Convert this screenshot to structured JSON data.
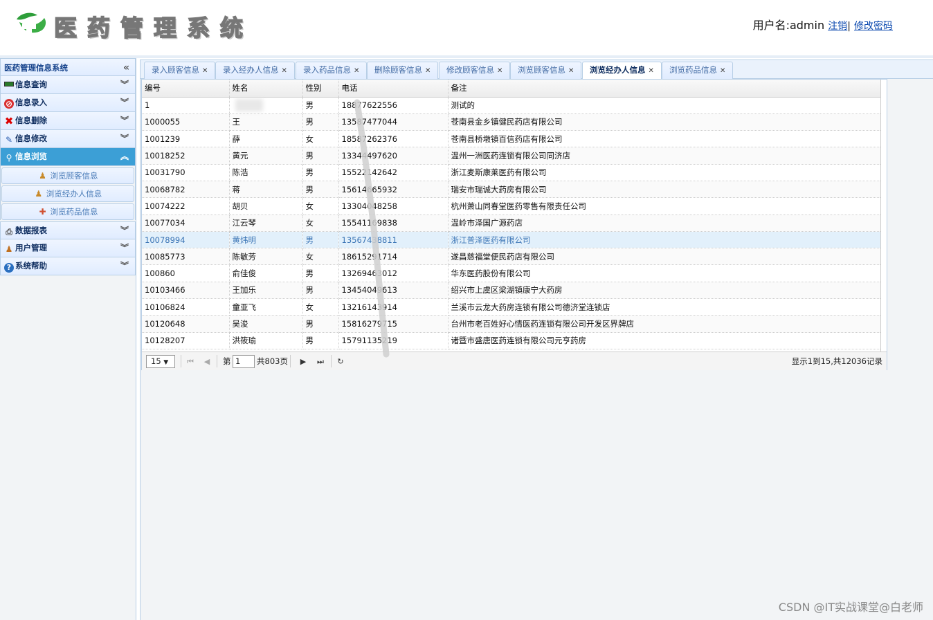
{
  "header": {
    "app_title": "医药管理系统",
    "user_label": "用户名:admin",
    "logout_link": "注销",
    "separator": "|",
    "change_password_link": "修改密码"
  },
  "sidebar": {
    "title": "医药管理信息系统",
    "items": [
      {
        "label": "信息查询",
        "icon": "monitor-icon"
      },
      {
        "label": "信息录入",
        "icon": "record-icon"
      },
      {
        "label": "信息删除",
        "icon": "delete-x-icon"
      },
      {
        "label": "信息修改",
        "icon": "pencil-icon"
      },
      {
        "label": "信息浏览",
        "icon": "search-icon",
        "active": true
      },
      {
        "label": "数据报表",
        "icon": "printer-icon"
      },
      {
        "label": "用户管理",
        "icon": "user-icon"
      },
      {
        "label": "系统帮助",
        "icon": "help-icon"
      }
    ],
    "subitems": [
      {
        "label": "浏览顾客信息",
        "icon": "customer-icon"
      },
      {
        "label": "浏览经办人信息",
        "icon": "agent-icon"
      },
      {
        "label": "浏览药品信息",
        "icon": "medicine-icon"
      }
    ]
  },
  "tabs": [
    {
      "label": "录入顾客信息"
    },
    {
      "label": "录入经办人信息"
    },
    {
      "label": "录入药品信息"
    },
    {
      "label": "删除顾客信息"
    },
    {
      "label": "修改顾客信息"
    },
    {
      "label": "浏览顾客信息"
    },
    {
      "label": "浏览经办人信息",
      "active": true
    },
    {
      "label": "浏览药品信息"
    }
  ],
  "grid": {
    "columns": [
      "编号",
      "姓名",
      "性别",
      "电话",
      "备注"
    ],
    "rows": [
      [
        "1",
        "",
        "男",
        "18877622556",
        "测试的"
      ],
      [
        "1000055",
        "王",
        "男",
        "13587477044",
        "苍南县金乡镇健民药店有限公司"
      ],
      [
        "1001239",
        "薛",
        "女",
        "18587262376",
        "苍南县桥墩镇百信药店有限公司"
      ],
      [
        "10018252",
        "黄元",
        "男",
        "13344497620",
        "温州一洲医药连锁有限公司同济店"
      ],
      [
        "10031790",
        "陈浩",
        "男",
        "15522142642",
        "浙江麦斯康莱医药有限公司"
      ],
      [
        "10068782",
        "蒋",
        "男",
        "15614665932",
        "瑞安市瑞诚大药房有限公司"
      ],
      [
        "10074222",
        "胡贝",
        "女",
        "13304048258",
        "杭州萧山同春堂医药零售有限责任公司"
      ],
      [
        "10077034",
        "江云琴",
        "女",
        "15541169838",
        "温岭市泽国广源药店"
      ],
      [
        "10078994",
        "黄炜明",
        "男",
        "13567438811",
        "浙江普泽医药有限公司"
      ],
      [
        "10085773",
        "陈敏芳",
        "女",
        "18615291714",
        "遂昌慈福堂便民药店有限公司"
      ],
      [
        "100860",
        "俞佳俊",
        "男",
        "13269463012",
        "华东医药股份有限公司"
      ],
      [
        "10103466",
        "王加乐",
        "男",
        "13454049613",
        "绍兴市上虞区梁湖镇康宁大药房"
      ],
      [
        "10106824",
        "童亚飞",
        "女",
        "13216143914",
        "兰溪市云龙大药房连锁有限公司德济堂连锁店"
      ],
      [
        "10120648",
        "吴浚",
        "男",
        "15816279715",
        "台州市老百姓好心情医药连锁有限公司开发区界牌店"
      ],
      [
        "10128207",
        "洪筱瑜",
        "男",
        "15791135219",
        "诸暨市盛唐医药连锁有限公司元亨药房"
      ]
    ]
  },
  "pager": {
    "page_size": "15",
    "page_prefix": "第",
    "current_page": "1",
    "total_pages_text": "共803页",
    "summary": "显示1到15,共12036记录"
  },
  "watermark": "CSDN @IT实战课堂@白老师"
}
